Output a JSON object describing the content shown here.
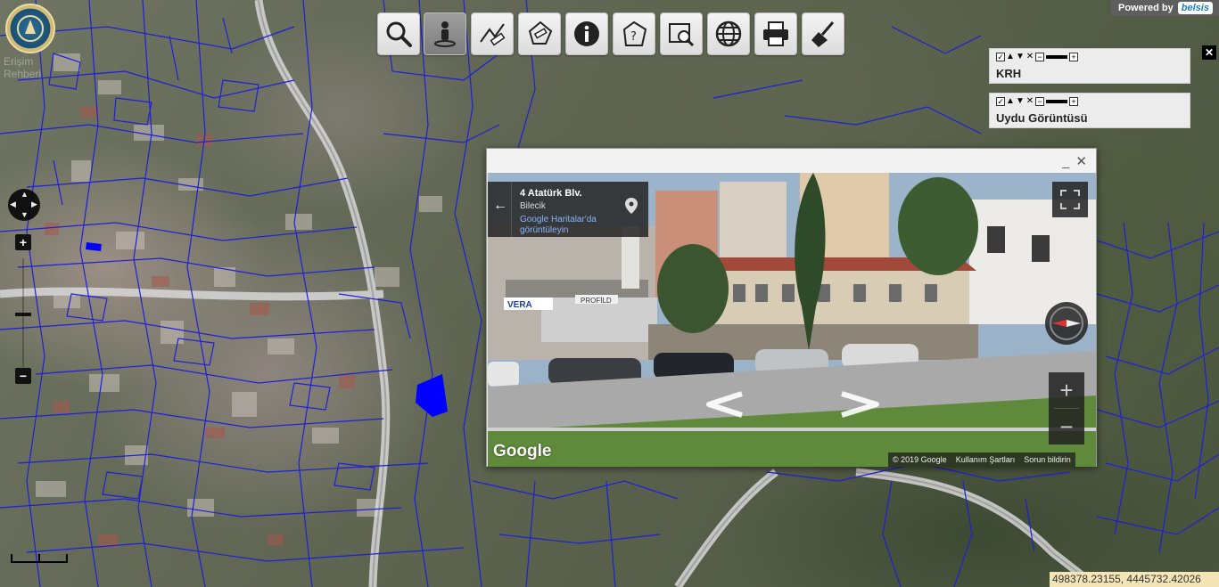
{
  "map": {
    "logo_label": "Erişim Rehberi",
    "coordinates": "498378.23155, 4445732.42026",
    "powered_by": "Powered by",
    "brand": "belsis",
    "scale_label": ""
  },
  "toolbar": {
    "buttons": [
      {
        "icon": "magnifier-icon",
        "label": "Search"
      },
      {
        "icon": "person-streetview-icon",
        "label": "Street View",
        "active": true
      },
      {
        "icon": "measure-distance-icon",
        "label": "Measure distance"
      },
      {
        "icon": "measure-area-icon",
        "label": "Measure area"
      },
      {
        "icon": "info-icon",
        "label": "Info"
      },
      {
        "icon": "query-tag-icon",
        "label": "Query"
      },
      {
        "icon": "zoom-extent-icon",
        "label": "Zoom"
      },
      {
        "icon": "globe-icon",
        "label": "Globe"
      },
      {
        "icon": "printer-icon",
        "label": "Print"
      },
      {
        "icon": "broom-icon",
        "label": "Clear"
      }
    ]
  },
  "layers": {
    "items": [
      {
        "name": "KRH",
        "checked": true
      },
      {
        "name": "Uydu Görüntüsü",
        "checked": true
      }
    ],
    "controls": {
      "checkbox": "✓",
      "up": "▲",
      "down": "▼",
      "remove": "✕",
      "minus": "−",
      "plus": "+"
    },
    "close": "✕"
  },
  "nav": {
    "zoom_in": "+",
    "zoom_out": "−"
  },
  "streetview": {
    "minimize": "_",
    "close": "✕",
    "address_line1": "4 Atatürk Blv.",
    "address_line2": "Bilecik",
    "maps_link": "Google Haritalar'da görüntüleyin",
    "back": "←",
    "google_logo": "Google",
    "copyright": "© 2019 Google",
    "terms": "Kullanım Şartları",
    "report": "Sorun bildirin",
    "zoom_in": "+",
    "zoom_out": "−",
    "sign_left": "VERA",
    "sign_right": "PROFİLD"
  },
  "colors": {
    "parcel_lines": "#1f1fd9",
    "selected_parcel": "#0000ff",
    "toolbar_bg": "#e6e6e6",
    "coords_bg": "#f3e5b5"
  }
}
